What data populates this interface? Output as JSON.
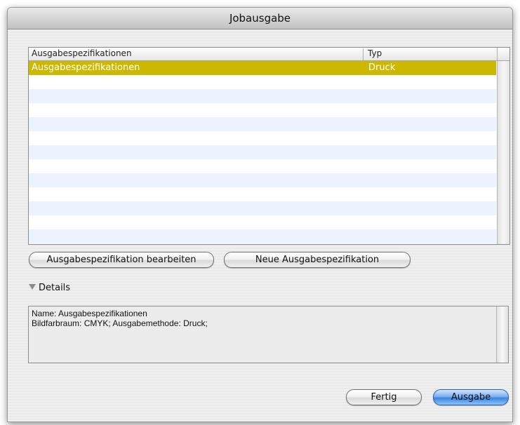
{
  "window": {
    "title": "Jobausgabe"
  },
  "list": {
    "columns": [
      "Ausgabespezifikationen",
      "Typ"
    ],
    "rows": [
      {
        "name": "Ausgabespezifikationen",
        "type": "Druck",
        "selected": true
      }
    ],
    "selected_color": "#cdb800",
    "stripe_color": "#edf3fe"
  },
  "buttons": {
    "edit": "Ausgabespezifikation bearbeiten",
    "new": "Neue Ausgabespezifikation",
    "done": "Fertig",
    "output": "Ausgabe"
  },
  "details": {
    "label": "Details",
    "line1": "Name: Ausgabespezifikationen",
    "line2": "Bildfarbraum: CMYK; Ausgabemethode: Druck;"
  }
}
